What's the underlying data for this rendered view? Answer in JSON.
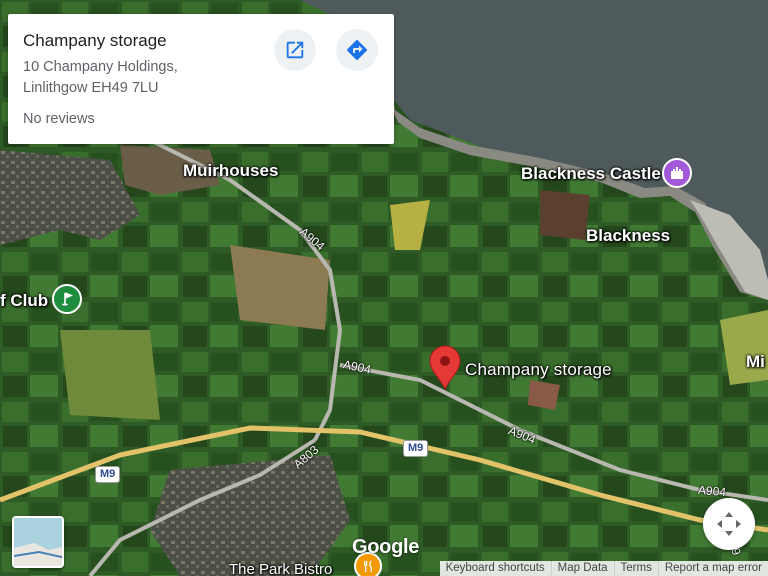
{
  "card": {
    "title": "Champany storage",
    "address_line1": "10 Champany Holdings,",
    "address_line2": "Linlithgow EH49 7LU",
    "reviews": "No reviews",
    "open_icon": "open-in-new-icon",
    "directions_icon": "directions-icon"
  },
  "places": {
    "muirhouses": "Muirhouses",
    "blackness_castle": "Blackness Castle",
    "blackness": "Blackness",
    "golf_club": "f Club",
    "mi": "Mi",
    "pin_label": "Champany storage",
    "park_bistro": "The Park Bistro"
  },
  "roads": {
    "a904_north": "A904",
    "a904_mid": "A904",
    "a904_east": "A904",
    "a904_far_east": "A904",
    "a803": "A803",
    "m9_left": "M9",
    "m9_center": "M9",
    "m9_right": "M9"
  },
  "branding": {
    "google": "Google"
  },
  "footer": {
    "keyboard": "Keyboard shortcuts",
    "map_data": "Map Data",
    "terms": "Terms",
    "report": "Report a map error"
  },
  "colors": {
    "pin": "#e53935",
    "castle_poi": "#a259d9",
    "golf_poi": "#1e8e3e",
    "restaurant_poi": "#f29900",
    "card_icon": "#1a73e8"
  }
}
